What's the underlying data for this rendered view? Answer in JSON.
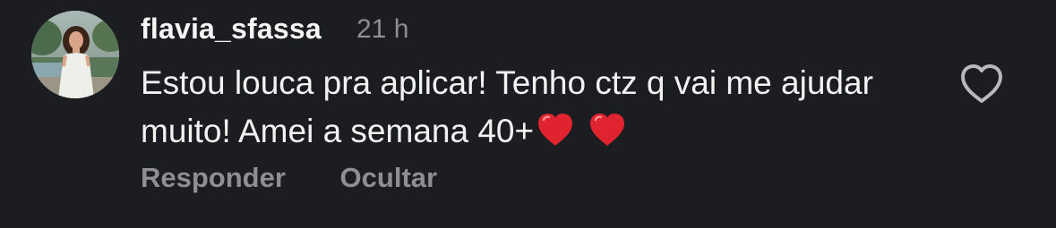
{
  "comment": {
    "username": "flavia_sfassa",
    "timestamp": "21 h",
    "text": "Estou louca pra aplicar! Tenho ctz q vai me ajudar muito! Amei a semana 40+",
    "emoji_count": 2,
    "emoji_icon": "red-heart-emoji",
    "actions": {
      "reply_label": "Responder",
      "hide_label": "Ocultar"
    },
    "like_icon": "heart-outline-icon"
  },
  "colors": {
    "background": "#1c1d20",
    "primary_text": "#f2f2f2",
    "secondary_text": "#8e8e93",
    "heart_red": "#e0242f"
  }
}
